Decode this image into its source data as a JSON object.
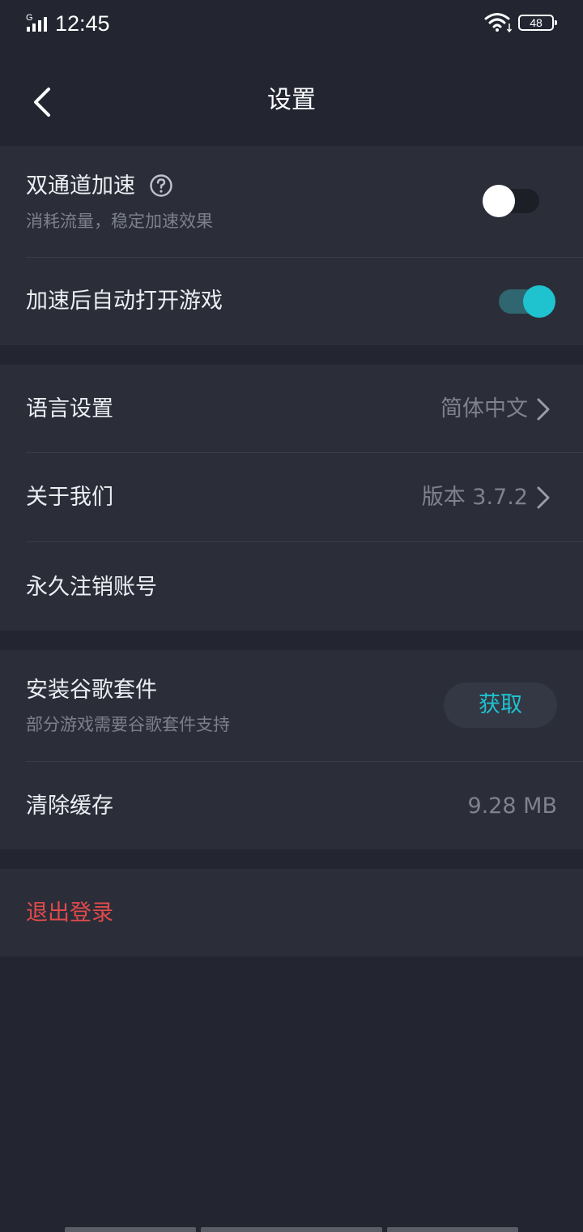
{
  "status_bar": {
    "network": "G",
    "time": "12:45",
    "battery": "48"
  },
  "header": {
    "title": "设置"
  },
  "acceleration": {
    "dual_channel": {
      "label": "双通道加速",
      "description": "消耗流量，稳定加速效果",
      "enabled": false
    },
    "auto_open": {
      "label": "加速后自动打开游戏",
      "enabled": true
    }
  },
  "general": {
    "language": {
      "label": "语言设置",
      "value": "简体中文"
    },
    "about": {
      "label": "关于我们",
      "value": "版本 3.7.2"
    },
    "delete_account": {
      "label": "永久注销账号"
    }
  },
  "tools": {
    "google_suite": {
      "label": "安装谷歌套件",
      "description": "部分游戏需要谷歌套件支持",
      "button": "获取"
    },
    "clear_cache": {
      "label": "清除缓存",
      "value": "9.28 MB"
    }
  },
  "account": {
    "logout": "退出登录"
  },
  "colors": {
    "background": "#232631",
    "card": "#2b2e39",
    "accent": "#1ec3cf",
    "danger": "#e24a4a"
  }
}
